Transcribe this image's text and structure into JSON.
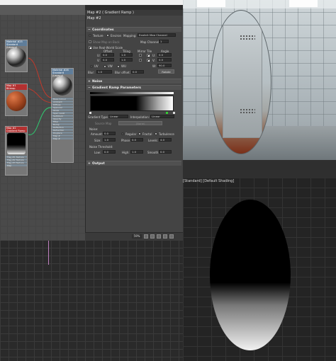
{
  "slate": {
    "nodes": [
      {
        "title": "Material #25",
        "subtitle": "Standard (Legacy)",
        "kind": "chrome"
      },
      {
        "title": "Map #1",
        "subtitle": "Bitmap",
        "kind": "copper"
      },
      {
        "title": "Map #2",
        "subtitle": "Gradient Ramp",
        "kind": "dark"
      },
      {
        "title": "Material #26",
        "subtitle": "Standard (Legacy)",
        "kind": "chrome"
      }
    ],
    "gradient_slots": [
      "Flag #1 Texture",
      "Flag #2 Texture",
      "Flag #3 Texture",
      "Map"
    ],
    "material_slots": [
      "Base Colour",
      "Ambient",
      "Diffuse",
      "Specular",
      "Gloss",
      "Spec Level",
      "Self-Illum",
      "Opacity",
      "Filter",
      "Bump",
      "Reflection",
      "Refraction",
      "Displace",
      "Map #",
      "Map #"
    ]
  },
  "param_editor": {
    "title": "Map #2 ( Gradient Ramp )",
    "name": "Map #2",
    "coordinates": {
      "header": "Coordinates",
      "texture_label": "Texture",
      "environ_label": "Environ",
      "mapping_label": "Mapping:",
      "mapping_value": "Explicit Map Channel",
      "show_map_label": "Show Map on Back",
      "map_channel_label": "Map Channel:",
      "map_channel_value": "1",
      "real_world_label": "Use Real-World Scale",
      "col_offset": "Offset",
      "col_tiling": "Tiling",
      "col_mirror": "Mirror Tile",
      "col_angle": "Angle",
      "u_label": "U:",
      "v_label": "V:",
      "w_label": "W:",
      "u_offset": "0.0",
      "v_offset": "0.0",
      "u_tiling": "1.0",
      "v_tiling": "1.0",
      "u_angle": "0.0",
      "v_angle": "0.0",
      "w_angle": "90.0",
      "uv_label": "UV",
      "vw_label": "VW",
      "wu_label": "WU",
      "blur_label": "Blur:",
      "blur_value": "1.0",
      "blur_offset_label": "Blur offset:",
      "blur_offset_value": "0.0",
      "rotate_label": "Rotate"
    },
    "noise_header": "Noise",
    "gradient": {
      "header": "Gradient Ramp Parameters",
      "type_label": "Gradient Type:",
      "type_value": "Linear",
      "interp_label": "Interpolation:",
      "interp_value": "Linear",
      "source_map_label": "Source Map",
      "source_map_value": "(None)",
      "noise_label": "Noise:",
      "amount_label": "Amount:",
      "amount_value": "0.0",
      "regular_label": "Regular",
      "fractal_label": "Fractal",
      "turbulence_label": "Turbulence",
      "size_label": "Size:",
      "size_value": "1.0",
      "phase_label": "Phase:",
      "phase_value": "0.0",
      "levels_label": "Levels:",
      "levels_value": "4.0",
      "threshold_label": "Noise Threshold:",
      "low_label": "Low:",
      "low_value": "0.0",
      "high_label": "High:",
      "high_value": "1.0",
      "smooth_label": "Smooth:",
      "smooth_value": "0.0"
    },
    "output_header": "Output",
    "zoom": "59%"
  },
  "viewport": {
    "label": "[Standard] [Default Shading]"
  },
  "colors": {
    "accent": "#4fb5ff",
    "copper": "#a0451f",
    "ramp_start": "#000000",
    "ramp_end": "#ffffff"
  }
}
